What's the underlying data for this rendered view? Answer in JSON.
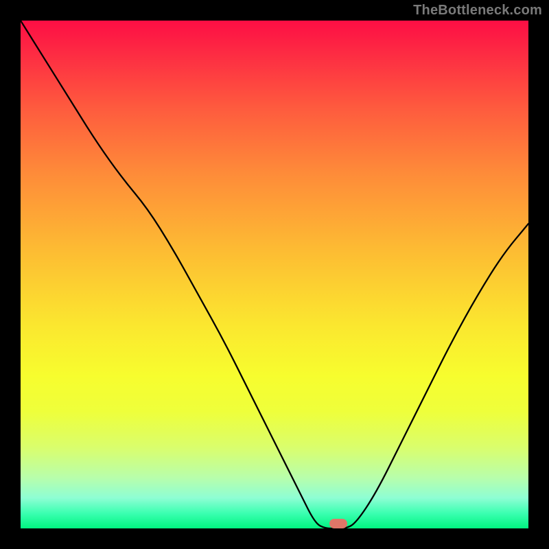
{
  "watermark": "TheBottleneck.com",
  "marker": {
    "x_pct": 62.5,
    "y_pct": 99.0,
    "color": "#e07668"
  },
  "chart_data": {
    "type": "line",
    "title": "",
    "xlabel": "",
    "ylabel": "",
    "xlim": [
      0,
      100
    ],
    "ylim": [
      0,
      100
    ],
    "grid": false,
    "legend": false,
    "series": [
      {
        "name": "bottleneck-curve",
        "x": [
          0,
          5,
          10,
          15,
          20,
          25,
          30,
          35,
          40,
          45,
          50,
          55,
          58,
          60,
          62,
          64,
          66,
          70,
          75,
          80,
          85,
          90,
          95,
          100
        ],
        "y": [
          100,
          92,
          84,
          76,
          69,
          63,
          55,
          46,
          37,
          27,
          17,
          7,
          1,
          0,
          0,
          0,
          1,
          7,
          17,
          27,
          37,
          46,
          54,
          60
        ]
      }
    ],
    "annotations": [
      {
        "type": "marker",
        "x": 62.5,
        "y": 0,
        "label": "optimal-point"
      }
    ],
    "background": {
      "type": "vertical-gradient",
      "stops": [
        {
          "pct": 0,
          "color": "#fd0e44"
        },
        {
          "pct": 17,
          "color": "#fe5a3e"
        },
        {
          "pct": 45,
          "color": "#fdbb33"
        },
        {
          "pct": 70,
          "color": "#f7fd2e"
        },
        {
          "pct": 90,
          "color": "#b8feab"
        },
        {
          "pct": 100,
          "color": "#00f580"
        }
      ]
    }
  }
}
